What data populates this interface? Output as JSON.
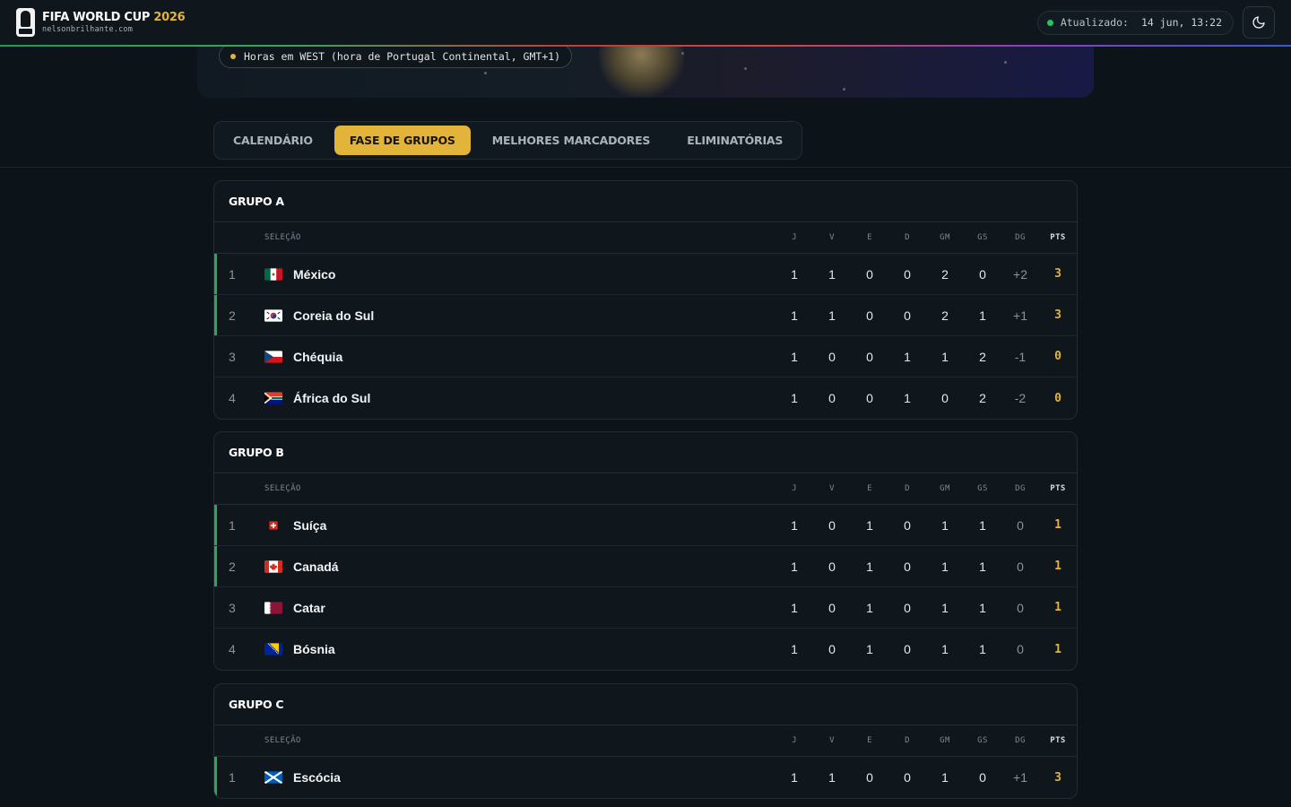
{
  "header": {
    "title": "FIFA WORLD CUP",
    "year": "2026",
    "site": "nelsonbrilhante.com",
    "updated_label": "Atualizado:",
    "updated_value": "14 jun, 13:22"
  },
  "hero": {
    "timezone_note": "Horas em WEST (hora de Portugal Continental, GMT+1)"
  },
  "tabs": [
    {
      "label": "CALENDÁRIO",
      "active": false
    },
    {
      "label": "FASE DE GRUPOS",
      "active": true
    },
    {
      "label": "MELHORES MARCADORES",
      "active": false
    },
    {
      "label": "ELIMINATÓRIAS",
      "active": false
    }
  ],
  "columns": {
    "team": "SELEÇÃO",
    "j": "J",
    "v": "V",
    "e": "E",
    "d": "D",
    "gm": "GM",
    "gs": "GS",
    "dg": "DG",
    "pts": "PTS"
  },
  "colors": {
    "accent": "#e2b43a",
    "qualified": "#2aa55a",
    "background": "#0d1419"
  },
  "groups": [
    {
      "title": "GRUPO A",
      "rows": [
        {
          "pos": "1",
          "flag": "flag-mexico",
          "team": "México",
          "j": "1",
          "v": "1",
          "e": "0",
          "d": "0",
          "gm": "2",
          "gs": "0",
          "dg": "+2",
          "pts": "3",
          "qualified": true
        },
        {
          "pos": "2",
          "flag": "flag-south-korea",
          "team": "Coreia do Sul",
          "j": "1",
          "v": "1",
          "e": "0",
          "d": "0",
          "gm": "2",
          "gs": "1",
          "dg": "+1",
          "pts": "3",
          "qualified": true
        },
        {
          "pos": "3",
          "flag": "flag-czechia",
          "team": "Chéquia",
          "j": "1",
          "v": "0",
          "e": "0",
          "d": "1",
          "gm": "1",
          "gs": "2",
          "dg": "-1",
          "pts": "0",
          "qualified": false
        },
        {
          "pos": "4",
          "flag": "flag-south-africa",
          "team": "África do Sul",
          "j": "1",
          "v": "0",
          "e": "0",
          "d": "1",
          "gm": "0",
          "gs": "2",
          "dg": "-2",
          "pts": "0",
          "qualified": false
        }
      ]
    },
    {
      "title": "GRUPO B",
      "rows": [
        {
          "pos": "1",
          "flag": "flag-switzerland",
          "team": "Suíça",
          "j": "1",
          "v": "0",
          "e": "1",
          "d": "0",
          "gm": "1",
          "gs": "1",
          "dg": "0",
          "pts": "1",
          "qualified": true
        },
        {
          "pos": "2",
          "flag": "flag-canada",
          "team": "Canadá",
          "j": "1",
          "v": "0",
          "e": "1",
          "d": "0",
          "gm": "1",
          "gs": "1",
          "dg": "0",
          "pts": "1",
          "qualified": true
        },
        {
          "pos": "3",
          "flag": "flag-qatar",
          "team": "Catar",
          "j": "1",
          "v": "0",
          "e": "1",
          "d": "0",
          "gm": "1",
          "gs": "1",
          "dg": "0",
          "pts": "1",
          "qualified": false
        },
        {
          "pos": "4",
          "flag": "flag-bosnia",
          "team": "Bósnia",
          "j": "1",
          "v": "0",
          "e": "1",
          "d": "0",
          "gm": "1",
          "gs": "1",
          "dg": "0",
          "pts": "1",
          "qualified": false
        }
      ]
    },
    {
      "title": "GRUPO C",
      "rows": [
        {
          "pos": "1",
          "flag": "flag-scotland",
          "team": "Escócia",
          "j": "1",
          "v": "1",
          "e": "0",
          "d": "0",
          "gm": "1",
          "gs": "0",
          "dg": "+1",
          "pts": "3",
          "qualified": true
        }
      ]
    }
  ]
}
